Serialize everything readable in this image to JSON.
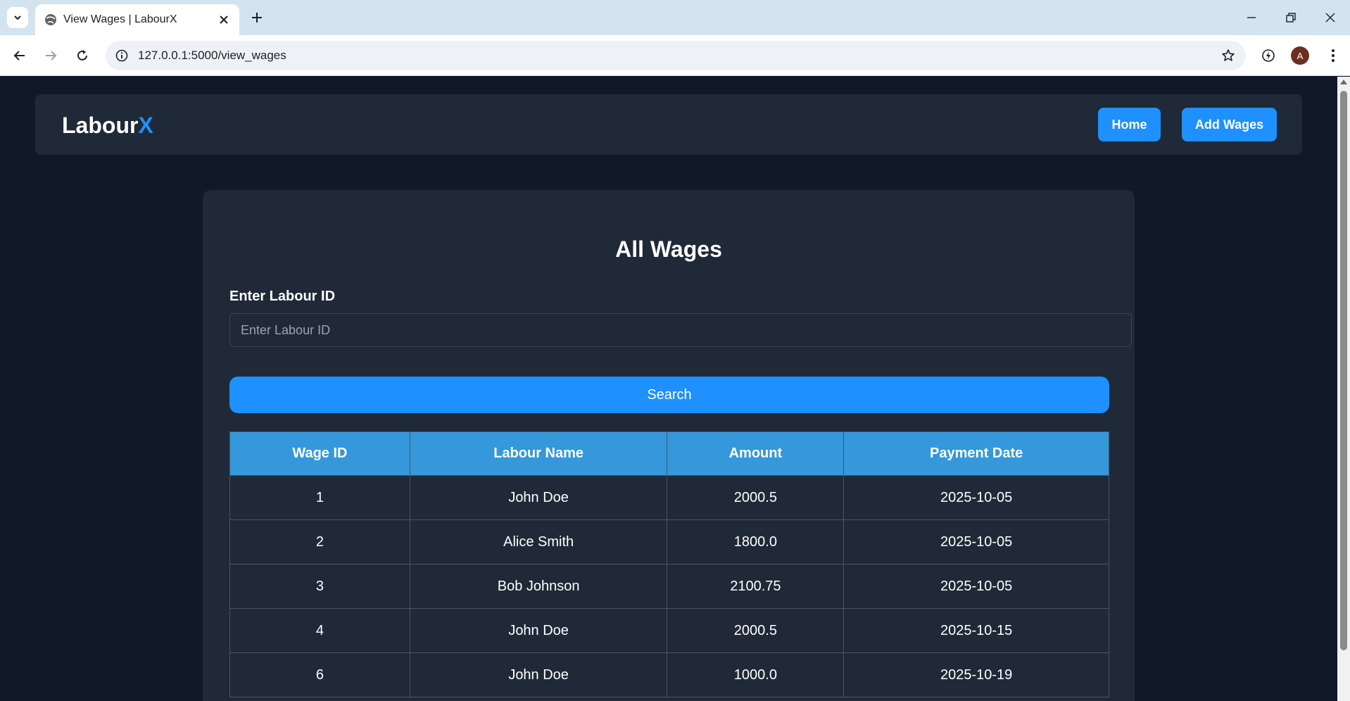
{
  "browser": {
    "tab_title": "View Wages | LabourX",
    "url": "127.0.0.1:5000/view_wages",
    "profile_initial": "A"
  },
  "navbar": {
    "brand_main": "Labour",
    "brand_accent": "X",
    "links": [
      "Home",
      "Add Wages"
    ]
  },
  "main": {
    "title": "All Wages",
    "label": "Enter Labour ID",
    "input_placeholder": "Enter Labour ID",
    "input_value": "",
    "search_label": "Search"
  },
  "table": {
    "headers": [
      "Wage ID",
      "Labour Name",
      "Amount",
      "Payment Date"
    ],
    "rows": [
      [
        "1",
        "John Doe",
        "2000.5",
        "2025-10-05"
      ],
      [
        "2",
        "Alice Smith",
        "1800.0",
        "2025-10-05"
      ],
      [
        "3",
        "Bob Johnson",
        "2100.75",
        "2025-10-05"
      ],
      [
        "4",
        "John Doe",
        "2000.5",
        "2025-10-15"
      ],
      [
        "6",
        "John Doe",
        "1000.0",
        "2025-10-19"
      ]
    ]
  },
  "colors": {
    "accent": "#1e90ff",
    "header": "#3498db",
    "card": "#1f2937",
    "background": "#111827"
  }
}
